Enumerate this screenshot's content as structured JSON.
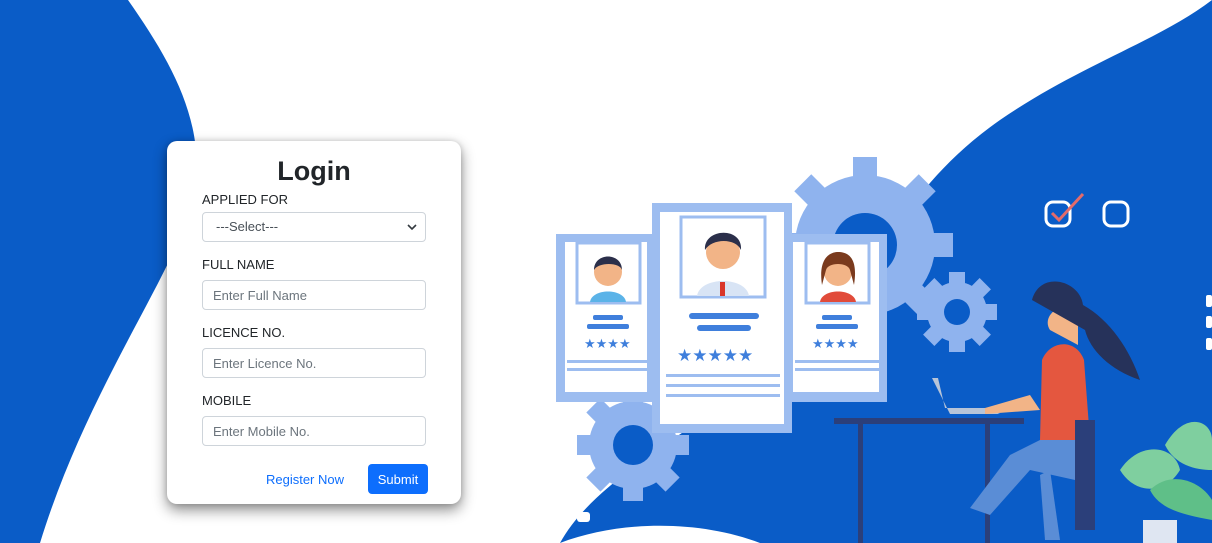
{
  "login": {
    "title": "Login",
    "applied_for_label": "APPLIED FOR",
    "applied_for_selected": "---Select---",
    "full_name_label": "FULL NAME",
    "full_name_placeholder": "Enter Full Name",
    "licence_label": "LICENCE NO.",
    "licence_placeholder": "Enter Licence No.",
    "mobile_label": "MOBILE",
    "mobile_placeholder": "Enter Mobile No.",
    "register_link": "Register Now",
    "submit_label": "Submit"
  },
  "theme": {
    "brand_blue": "#0a5cc7",
    "light_blue": "#9dbdf0",
    "button_blue": "#0d6efd"
  },
  "illustration": {
    "icons": [
      "profile-card-icon",
      "gear-icon",
      "checkbox-checked-icon",
      "checkbox-empty-icon",
      "person-at-laptop-icon",
      "plant-icon"
    ]
  }
}
